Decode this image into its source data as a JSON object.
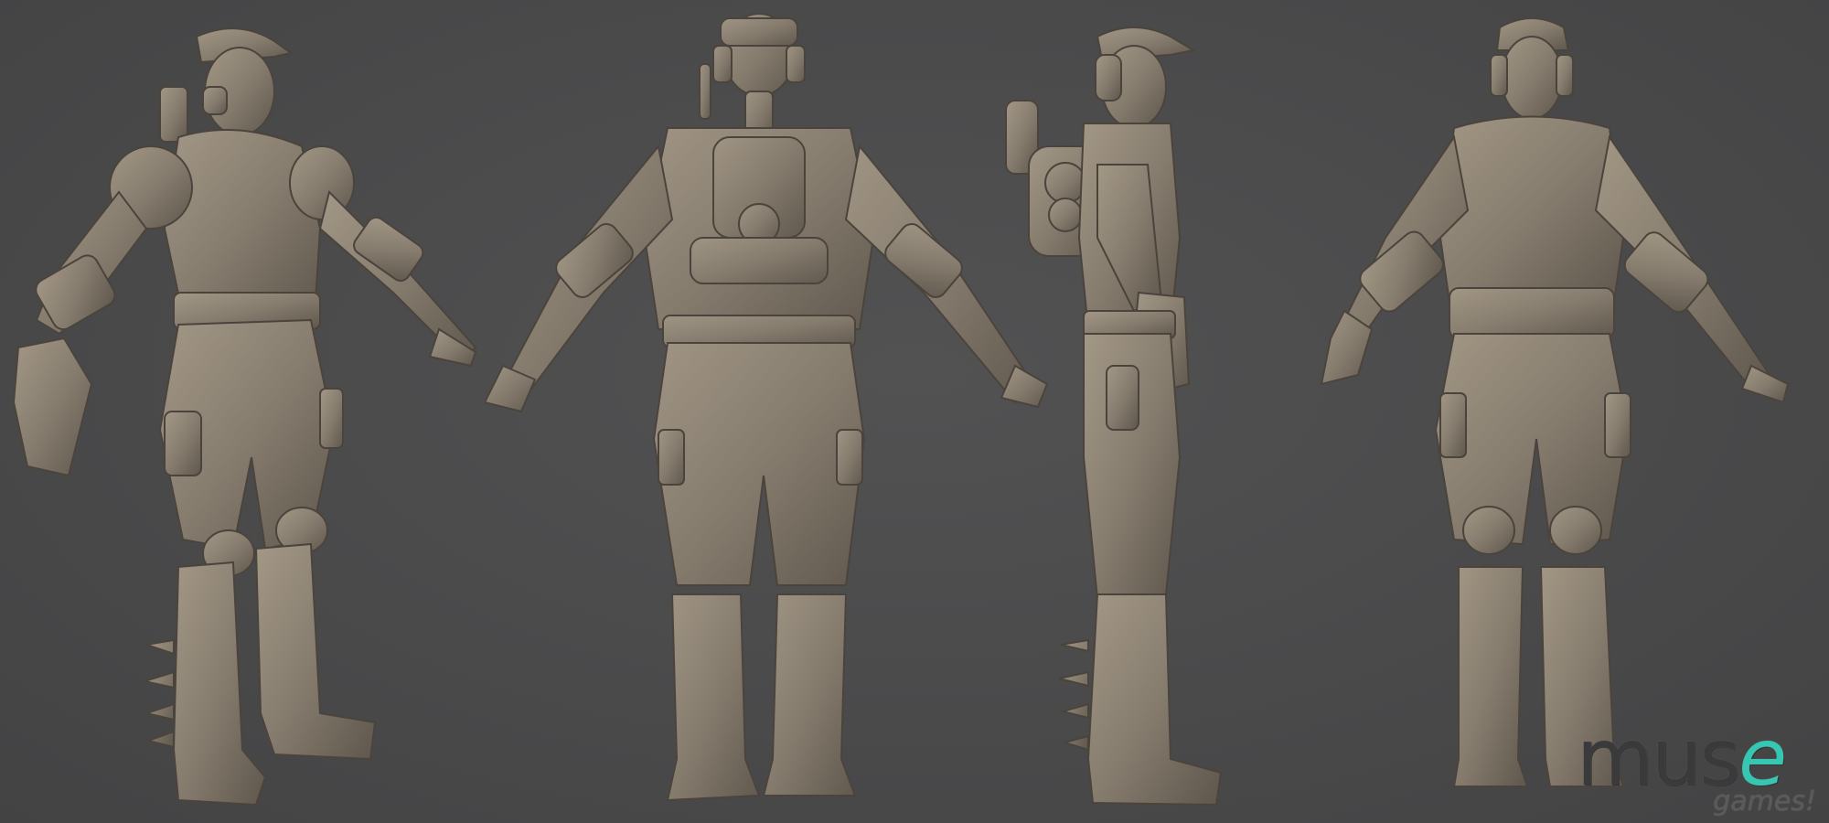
{
  "scene": {
    "background_color": "#4a4a4b",
    "sculpt_color": "#8b8174",
    "views": [
      "front-three-quarter",
      "back",
      "side",
      "front"
    ]
  },
  "logo": {
    "word_prefix": "mus",
    "word_accent": "e",
    "sub": "games!",
    "accent_color": "#36c6b1"
  }
}
